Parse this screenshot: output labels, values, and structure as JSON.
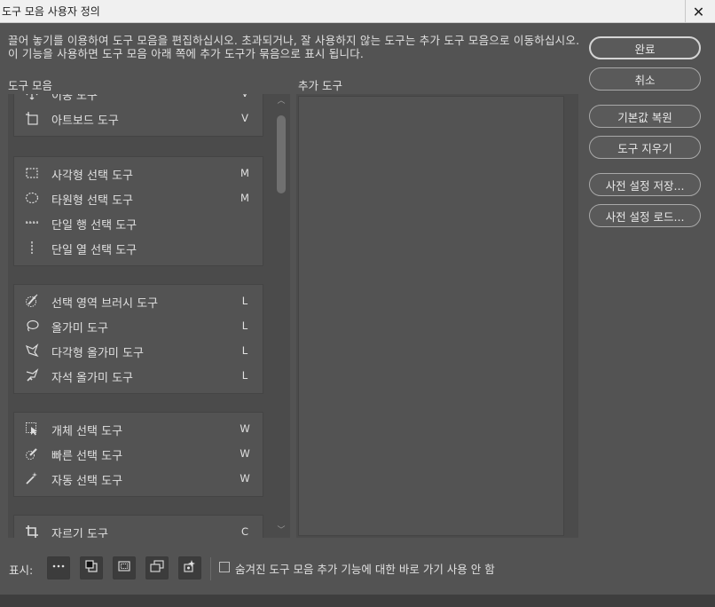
{
  "window": {
    "title": "도구 모음 사용자 정의",
    "close_label": "✕"
  },
  "instructions": "끌어 놓기를 이용하여 도구 모음을 편집하십시오. 초과되거나, 잘 사용하지 않는 도구는 추가 도구 모음으로 이동하십시오. 이 기능을 사용하면 도구 모음 아래 쪽에 추가 도구가 묶음으로 표시 됩니다.",
  "toolbar_label": "도구 모음",
  "extra_label": "추가 도구",
  "groups": [
    {
      "tools": [
        {
          "name": "이동 도구",
          "key": "V",
          "icon": "move-icon"
        },
        {
          "name": "아트보드 도구",
          "key": "V",
          "icon": "artboard-icon"
        }
      ]
    },
    {
      "tools": [
        {
          "name": "사각형 선택 도구",
          "key": "M",
          "icon": "rect-marquee-icon"
        },
        {
          "name": "타원형 선택 도구",
          "key": "M",
          "icon": "ellipse-marquee-icon"
        },
        {
          "name": "단일 행 선택 도구",
          "key": "",
          "icon": "single-row-icon"
        },
        {
          "name": "단일 열 선택 도구",
          "key": "",
          "icon": "single-column-icon"
        }
      ]
    },
    {
      "tools": [
        {
          "name": "선택 영역 브러시 도구",
          "key": "L",
          "icon": "selection-brush-icon"
        },
        {
          "name": "올가미 도구",
          "key": "L",
          "icon": "lasso-icon"
        },
        {
          "name": "다각형 올가미 도구",
          "key": "L",
          "icon": "polygonal-lasso-icon"
        },
        {
          "name": "자석 올가미 도구",
          "key": "L",
          "icon": "magnetic-lasso-icon"
        }
      ]
    },
    {
      "tools": [
        {
          "name": "개체 선택 도구",
          "key": "W",
          "icon": "object-select-icon"
        },
        {
          "name": "빠른 선택 도구",
          "key": "W",
          "icon": "quick-select-icon"
        },
        {
          "name": "자동 선택 도구",
          "key": "W",
          "icon": "magic-wand-icon"
        }
      ]
    },
    {
      "tools": [
        {
          "name": "자르기 도구",
          "key": "C",
          "icon": "crop-icon"
        }
      ]
    }
  ],
  "buttons": {
    "done": "완료",
    "cancel": "취소",
    "restore_defaults": "기본값 복원",
    "clear_tools": "도구 지우기",
    "save_preset": "사전 설정 저장...",
    "load_preset": "사전 설정 로드..."
  },
  "bottom": {
    "show_label": "표시:",
    "icons": [
      "more-icon",
      "foreground-background-icon",
      "quick-mask-icon",
      "screen-mode-icon",
      "edit-toolbar-icon"
    ],
    "checkbox_label": "숨겨진 도구 모음 추가 기능에 대한 바로 가기 사용 안 함",
    "checkbox_checked": false
  }
}
